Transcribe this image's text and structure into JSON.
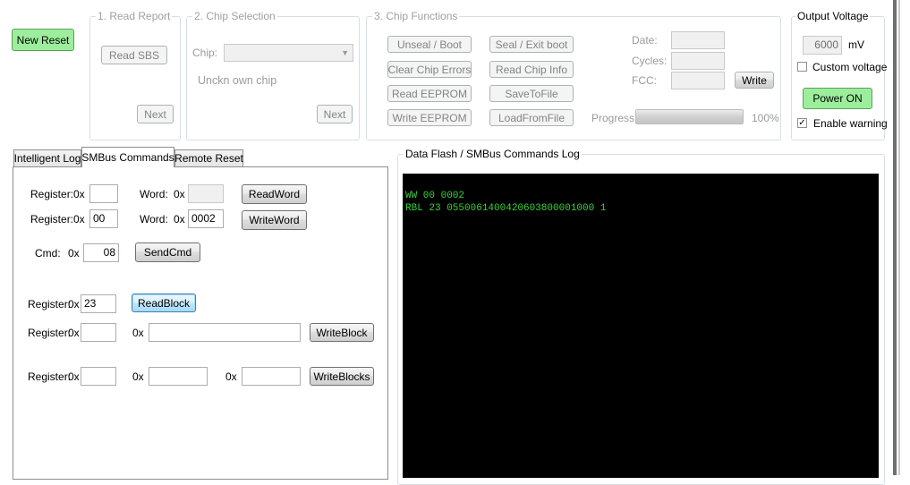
{
  "new_reset": "New Reset",
  "read_report": {
    "title": "1. Read Report",
    "read_sbs": "Read SBS",
    "next": "Next"
  },
  "chip_selection": {
    "title": "2. Chip Selection",
    "chip_label": "Chip:",
    "chip_value": "",
    "unknown_chip": "Unckn own chip",
    "next": "Next"
  },
  "chip_functions": {
    "title": "3. Chip Functions",
    "unseal_boot": "Unseal / Boot",
    "seal_exit_boot": "Seal / Exit boot",
    "clear_chip_errors": "Clear Chip Errors",
    "read_chip_info": "Read Chip Info",
    "read_eeprom": "Read EEPROM",
    "save_to_file": "SaveToFile",
    "write_eeprom": "Write EEPROM",
    "load_from_file": "LoadFromFile",
    "date_label": "Date:",
    "cycles_label": "Cycles:",
    "fcc_label": "FCC:",
    "date_value": "",
    "cycles_value": "",
    "fcc_value": "",
    "write": "Write",
    "progress_label": "Progress:",
    "progress_text": "100%",
    "progress_value": 1.0
  },
  "output_voltage": {
    "title": "Output Voltage",
    "value": "6000",
    "unit": "mV",
    "custom_voltage": "Custom voltage",
    "custom_checked": false,
    "power_on": "Power ON",
    "enable_warning": "Enable warning",
    "warning_checked": true
  },
  "tabs": [
    "Intelligent Log",
    "SMBus Commands",
    "Remote Reset"
  ],
  "smbus": {
    "row1": {
      "register_label": "Register:",
      "prefix": "0x",
      "register_value": "",
      "word_label": "Word:",
      "word_prefix": "0x",
      "word_value": "",
      "button": "ReadWord"
    },
    "row2": {
      "register_label": "Register:",
      "prefix": "0x",
      "register_value": "00",
      "word_label": "Word:",
      "word_prefix": "0x",
      "word_value": "0002",
      "button": "WriteWord"
    },
    "cmd": {
      "label": "Cmd:",
      "prefix": "0x",
      "value": "08",
      "button": "SendCmd"
    },
    "read_block": {
      "register_label": "Register:",
      "prefix": "0x",
      "value": "23",
      "button": "ReadBlock"
    },
    "write_block": {
      "register_label": "Register:",
      "prefix": "0x",
      "register_value": "",
      "data_prefix": "0x",
      "data_value": "",
      "button": "WriteBlock"
    },
    "write_blocks": {
      "register_label": "Register:",
      "prefix": "0x",
      "register_value": "",
      "data1_prefix": "0x",
      "data1_value": "",
      "data2_prefix": "0x",
      "data2_value": "",
      "button": "WriteBlocks"
    }
  },
  "log": {
    "title": "Data Flash / SMBus Commands Log",
    "lines": [
      "WW 00 0002",
      "RBL 23 0550061400420603800001000 1"
    ]
  },
  "colors": {
    "green_button": "#9cee9c",
    "log_text": "#3ad33a",
    "log_bg": "#000000"
  }
}
